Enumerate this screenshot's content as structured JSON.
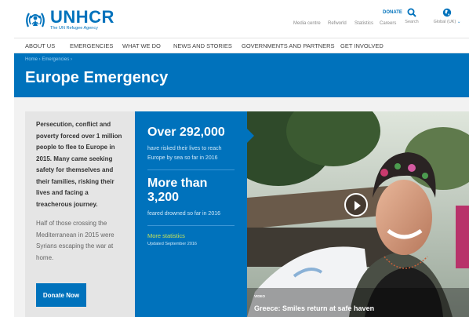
{
  "header": {
    "logo_text": "UNHCR",
    "logo_tagline": "The UN Refugee Agency",
    "utility_links": [
      "Media centre",
      "Refworld",
      "Statistics",
      "Careers"
    ],
    "donate_label": "DONATE",
    "search_label": "Search",
    "global_label": "Global (UK)"
  },
  "nav": {
    "items": [
      "ABOUT US",
      "EMERGENCIES",
      "WHAT WE DO",
      "NEWS AND STORIES",
      "GOVERNMENTS AND PARTNERS",
      "GET INVOLVED"
    ]
  },
  "banner": {
    "breadcrumb": "Home  ›  Emergencies  ›",
    "title": "Europe Emergency"
  },
  "intro": {
    "lead": "Persecution, conflict and poverty forced over 1 million people to flee to Europe in 2015. Many came seeking safety for themselves and their families, risking their lives and facing a treacherous journey.",
    "secondary": "Half of those crossing the Mediterranean in 2015 were Syrians escaping the war at home.",
    "donate_button": "Donate Now"
  },
  "stats": {
    "stat1_value": "Over 292,000",
    "stat1_text": "have risked their lives to reach Europe by sea so far in 2016",
    "stat2_value": "More than 3,200",
    "stat2_text": "feared drowned so far in 2016",
    "more_link": "More statistics",
    "updated": "Updated September 2016"
  },
  "video": {
    "tag": "VIDEO",
    "title": "Greece: Smiles return at safe haven"
  },
  "colors": {
    "brand_blue": "#0072bc",
    "link_green": "#c6e35a"
  }
}
